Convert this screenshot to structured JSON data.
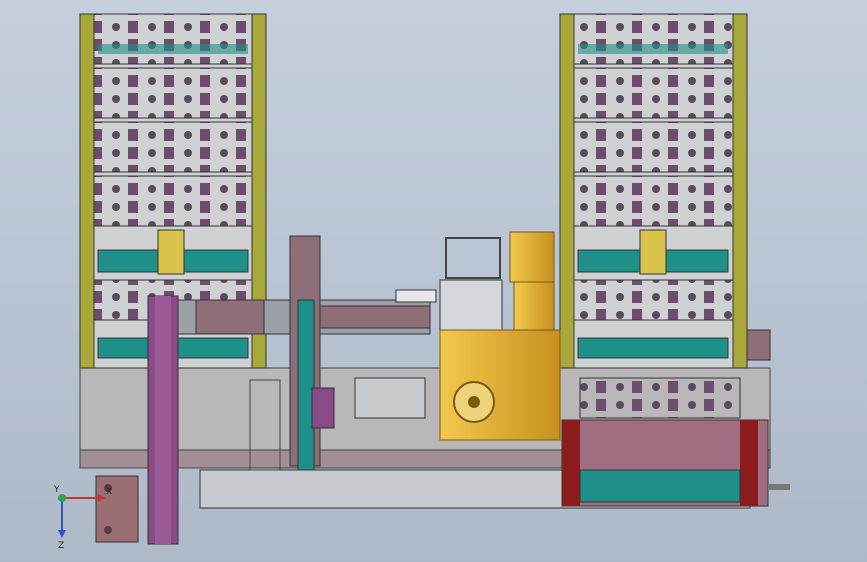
{
  "triad": {
    "x_label": "X",
    "y_label": "Y",
    "z_label": "Z"
  },
  "colors": {
    "frame_olive": "#a9a83a",
    "panel_gray": "#bfc1c4",
    "teal": "#1f8f8a",
    "purple": "#8a4a88",
    "mauve": "#8e6f78",
    "gold": "#e3b32c",
    "dark_red": "#8c1c1c",
    "steel": "#9aa0a6"
  },
  "icons": [
    "triad-axis-icon"
  ]
}
